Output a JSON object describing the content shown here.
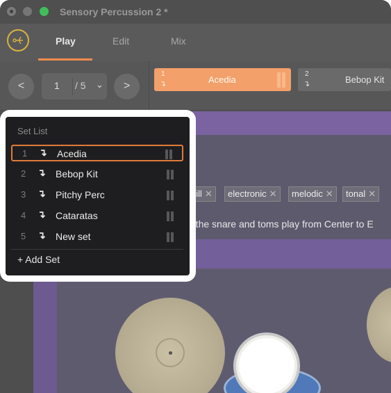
{
  "window": {
    "title": "Sensory Percussion 2 *"
  },
  "nav": {
    "tabs": [
      {
        "label": "Play",
        "active": true
      },
      {
        "label": "Edit",
        "active": false
      },
      {
        "label": "Mix",
        "active": false
      }
    ]
  },
  "controls": {
    "prev_label": "<",
    "next_label": ">",
    "page_current": "1",
    "page_total": "/ 5",
    "chevron": "⌄"
  },
  "set_chips": [
    {
      "index": "1",
      "name": "Acedia",
      "active": true
    },
    {
      "index": "2",
      "name": "Bebop Kit",
      "active": false
    }
  ],
  "tags": [
    {
      "label": "hill"
    },
    {
      "label": "electronic"
    },
    {
      "label": "melodic"
    },
    {
      "label": "tonal"
    }
  ],
  "description": "h the snare and toms play from Center to E",
  "set_list": {
    "title": "Set List",
    "items": [
      {
        "number": "1",
        "name": "Acedia",
        "selected": true
      },
      {
        "number": "2",
        "name": "Bebop Kit",
        "selected": false
      },
      {
        "number": "3",
        "name": "Pitchy Perc",
        "selected": false
      },
      {
        "number": "4",
        "name": "Cataratas",
        "selected": false
      },
      {
        "number": "5",
        "name": "New set",
        "selected": false
      }
    ],
    "add_label": "+ Add Set"
  },
  "icons": {
    "row_arrow": "↴",
    "tag_remove": "✕"
  },
  "colors": {
    "accent": "#f08a4b",
    "chip_active": "#f4a06a",
    "selection_border": "#e07a3a"
  }
}
